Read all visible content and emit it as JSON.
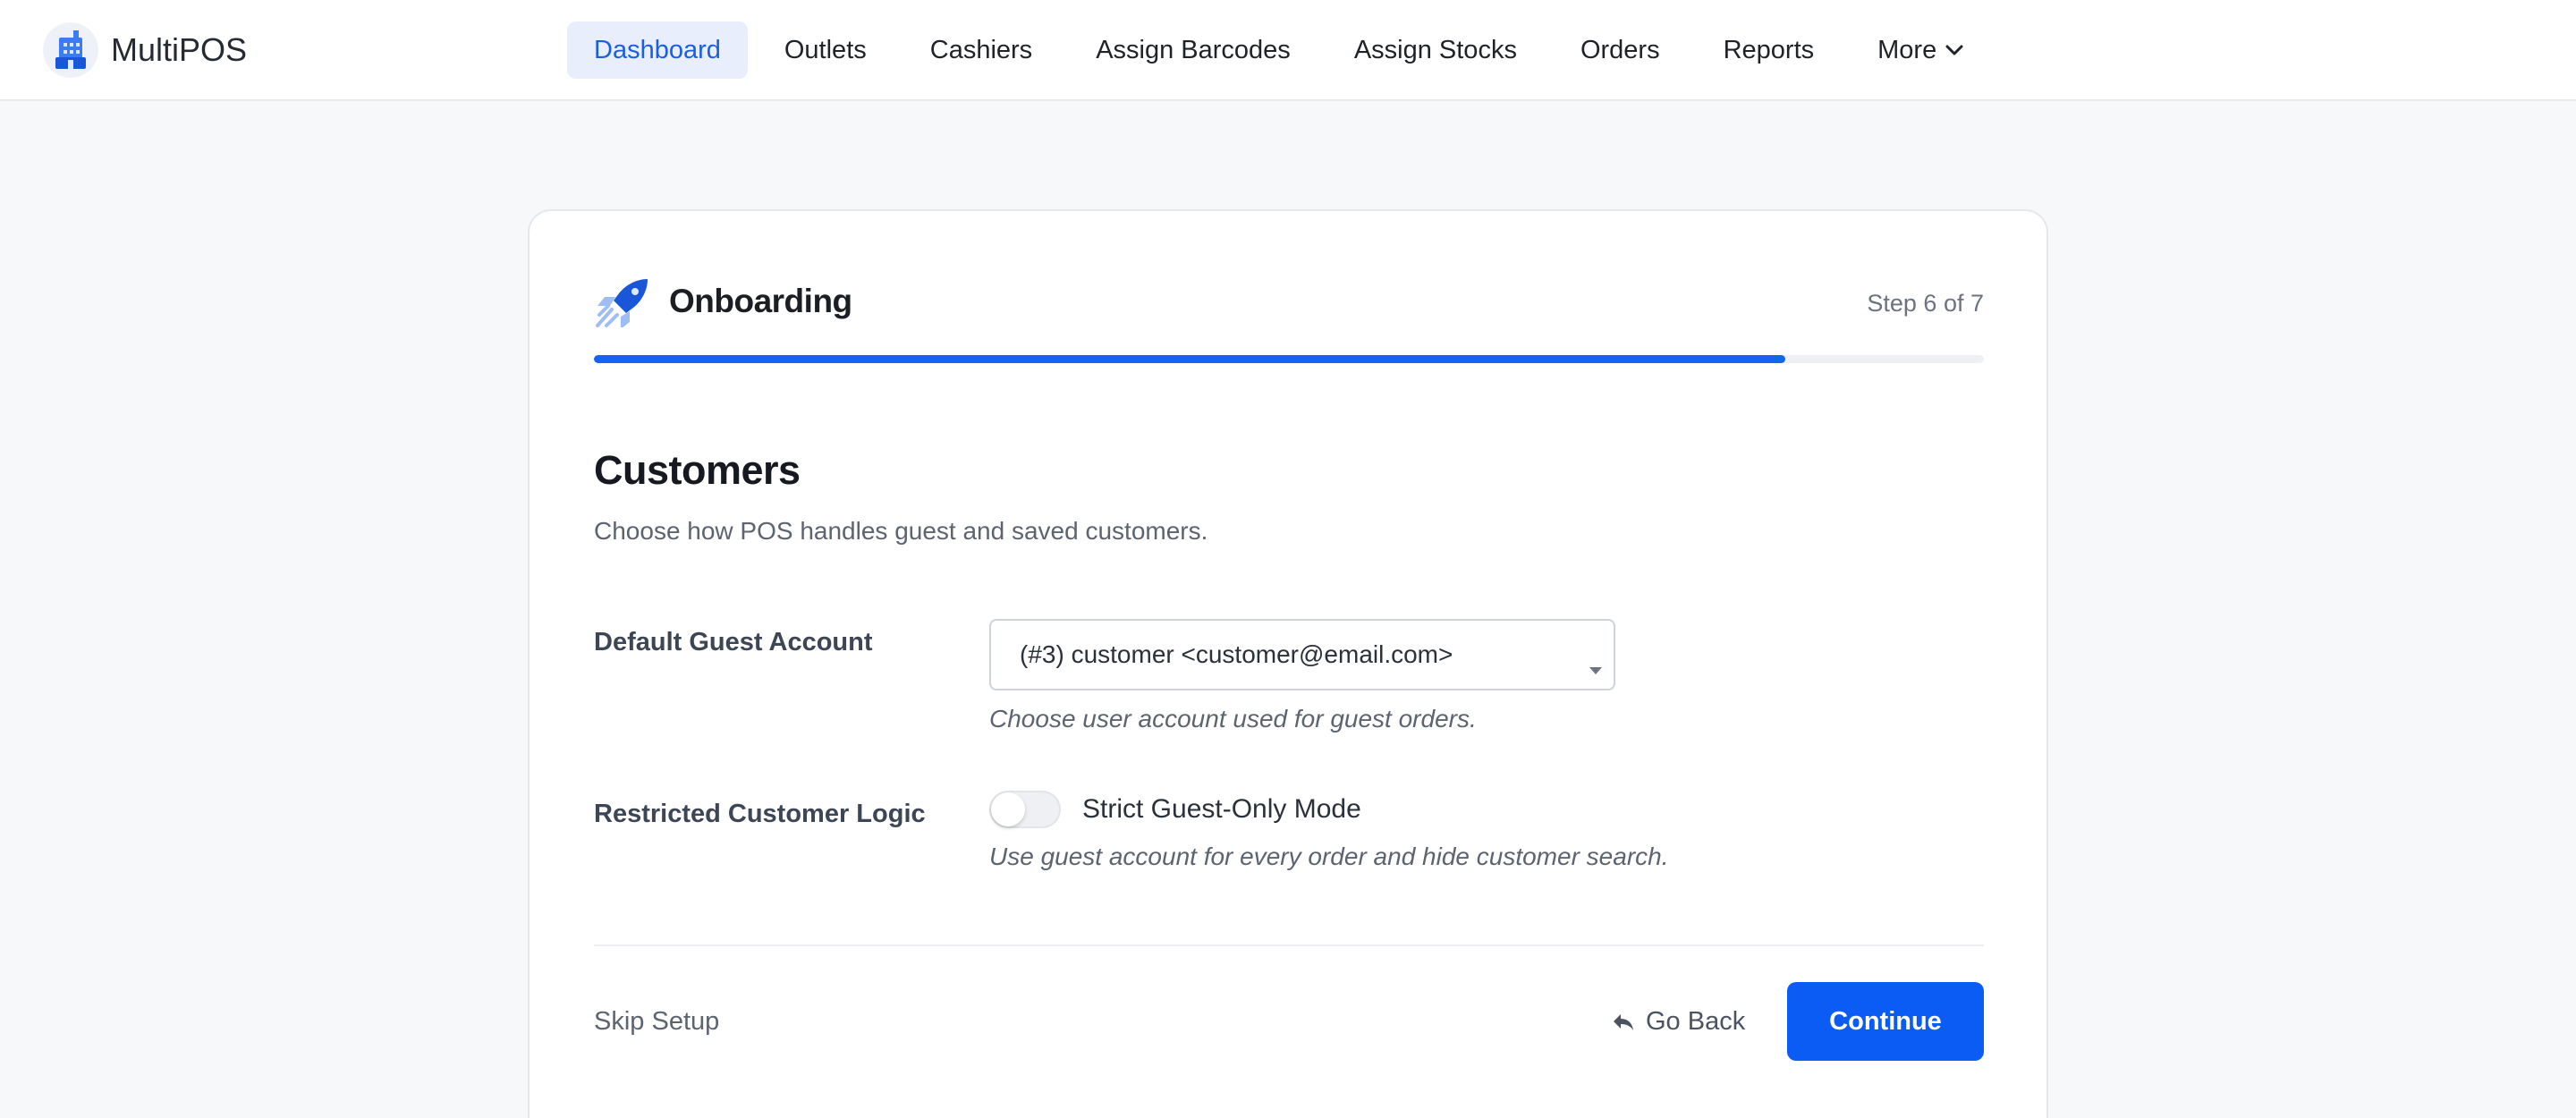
{
  "brand": {
    "name": "MultiPOS",
    "logo_icon": "store-building-icon"
  },
  "nav": {
    "items": [
      {
        "label": "Dashboard",
        "active": true
      },
      {
        "label": "Outlets",
        "active": false
      },
      {
        "label": "Cashiers",
        "active": false
      },
      {
        "label": "Assign Barcodes",
        "active": false
      },
      {
        "label": "Assign Stocks",
        "active": false
      },
      {
        "label": "Orders",
        "active": false
      },
      {
        "label": "Reports",
        "active": false
      },
      {
        "label": "More",
        "active": false,
        "icon": "chevron-down-icon"
      }
    ]
  },
  "onboarding": {
    "title": "Onboarding",
    "icon": "rocket-icon",
    "step_text": "Step 6 of 7",
    "progress_fraction": 0.857
  },
  "section": {
    "title": "Customers",
    "subtitle": "Choose how POS handles guest and saved customers."
  },
  "fields": {
    "guest_account": {
      "label": "Default Guest Account",
      "value": "(#3) customer <customer@email.com>",
      "hint": "Choose user account used for guest orders."
    },
    "restricted_logic": {
      "label": "Restricted Customer Logic",
      "toggle_label": "Strict Guest-Only Mode",
      "toggle_on": false,
      "hint": "Use guest account for every order and hide customer search."
    }
  },
  "footer": {
    "skip_label": "Skip Setup",
    "back_label": "Go Back",
    "back_icon": "reply-arrow-icon",
    "continue_label": "Continue"
  },
  "colors": {
    "accent": "#0a5cf5",
    "nav_active_bg": "#e8eefb",
    "nav_active_text": "#1a5fe0",
    "page_bg": "#f7f8fa"
  }
}
